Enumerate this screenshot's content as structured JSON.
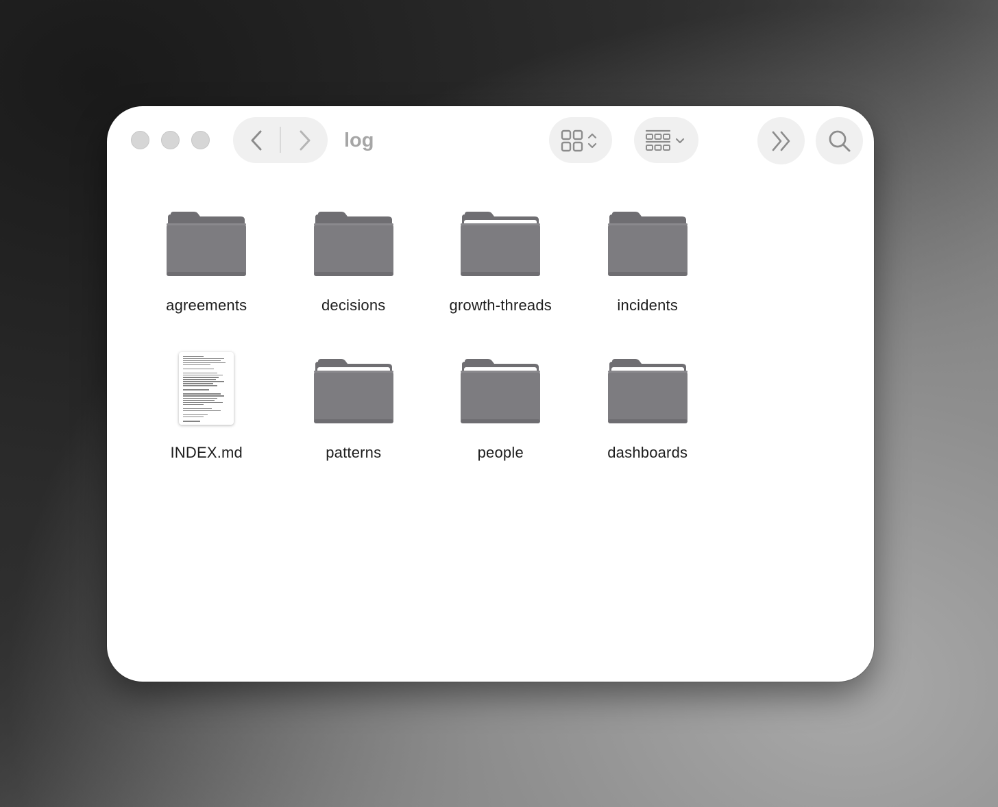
{
  "window": {
    "title": "log"
  },
  "toolbar": {
    "back_icon": "chevron-left-icon",
    "forward_icon": "chevron-right-icon",
    "view_icon": "icon-view-grid-icon",
    "group_icon": "group-by-icon",
    "more_icon": "double-chevron-right-icon",
    "search_icon": "search-icon"
  },
  "items": [
    {
      "name": "agreements",
      "kind": "folder"
    },
    {
      "name": "decisions",
      "kind": "folder"
    },
    {
      "name": "growth-threads",
      "kind": "folder"
    },
    {
      "name": "incidents",
      "kind": "folder"
    },
    {
      "name": "INDEX.md",
      "kind": "document"
    },
    {
      "name": "patterns",
      "kind": "folder"
    },
    {
      "name": "people",
      "kind": "folder"
    },
    {
      "name": "dashboards",
      "kind": "folder"
    }
  ],
  "colors": {
    "folder_body": "#7d7c80",
    "folder_tab": "#6f6e72",
    "folder_paper": "#ffffff",
    "toolbar_pill": "#f0f0f0",
    "icon_gray": "#8c8c8c",
    "title_gray": "#a6a6a6"
  }
}
